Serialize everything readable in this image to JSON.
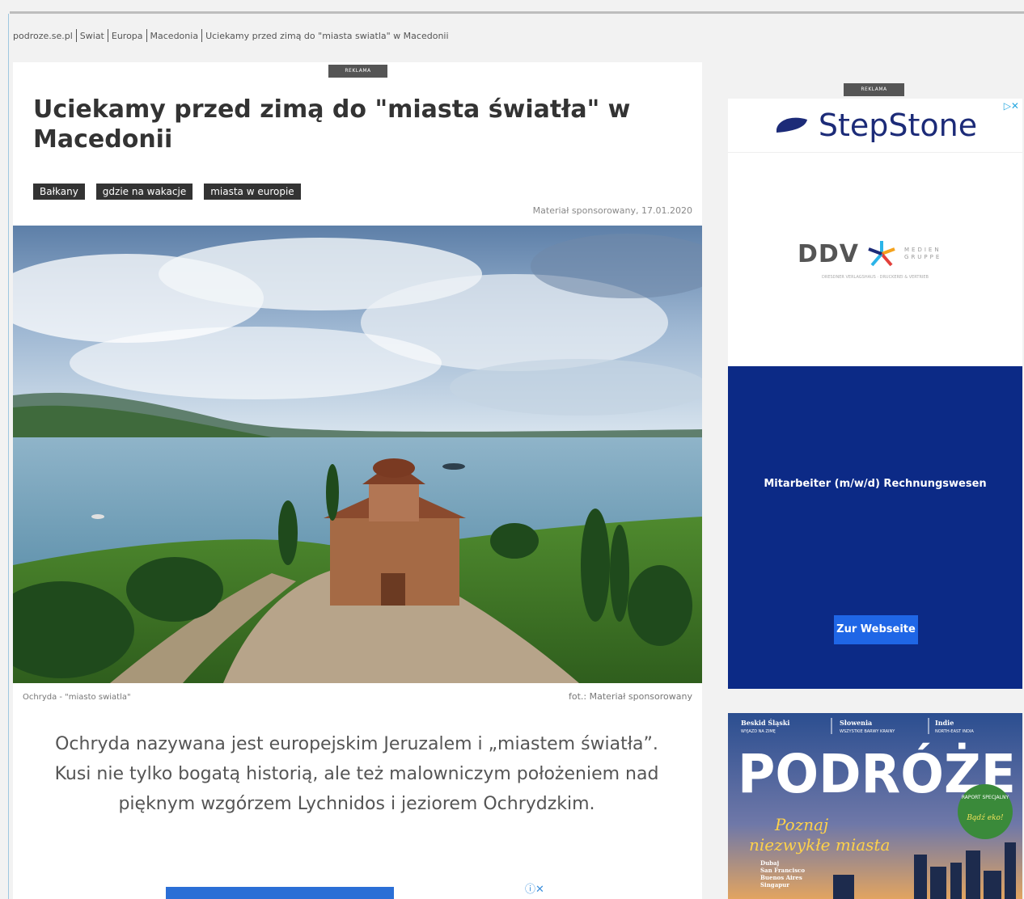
{
  "breadcrumb": [
    "podroze.se.pl",
    "Swiat",
    "Europa",
    "Macedonia",
    "Uciekamy przed zimą do \"miasta swiatla\" w Macedonii"
  ],
  "ad_label": "REKLAMA",
  "article": {
    "title": "Uciekamy przed zimą do \"miasta światła\" w Macedonii",
    "tags": [
      "Bałkany",
      "gdzie na wakacje",
      "miasta w europie"
    ],
    "meta": "Materiał sponsorowany, 17.01.2020",
    "image_caption": "Ochryda - \"miasto swiatla\"",
    "image_credit": "fot.: Materiał sponsorowany",
    "lead": "Ochryda nazywana jest europejskim Jeruzalem i „miastem światła”. Kusi nie tylko bogatą historią, ale też malowniczym położeniem nad pięknym wzgórzem Lychnidos i jeziorem Ochrydzkim."
  },
  "sidebar": {
    "ad1": {
      "brand": "StepStone",
      "ddv_brand": "DDV",
      "ddv_sub": "MEDIEN GRUPPE",
      "ddv_fine": "DRESDNER VERLAGSHAUS · DRUCKEREI & VERTRIEB",
      "job_title": "Mitarbeiter (m/w/d) Rechnungswesen",
      "cta": "Zur Webseite"
    },
    "ad2": {
      "headers": [
        "Beskid Śląski",
        "Słowenia",
        "Indie"
      ],
      "subheaders": [
        "WYJAZD NA ZIMĘ",
        "WSZYSTKIE BARWY KRAINY",
        "NORTH-EAST INDIA"
      ],
      "masthead": "PODRÓŻE",
      "badge_line1": "RAPORT SPECJALNY",
      "badge_line2": "Bądź eko!",
      "headline_line1": "Poznaj",
      "headline_line2": "niezwykłe miasta",
      "cities": [
        "Dubaj",
        "San Francisco",
        "Buenos Aires",
        "Singapur"
      ]
    }
  }
}
